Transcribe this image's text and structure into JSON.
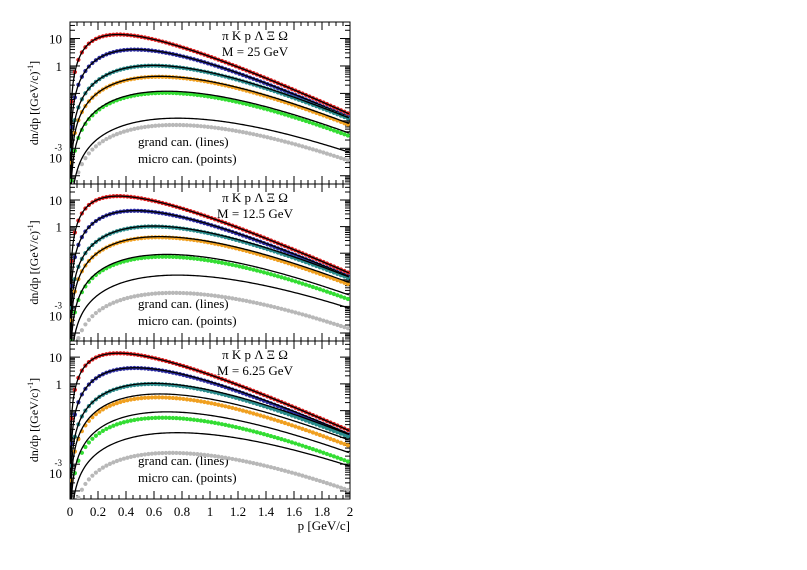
{
  "figure": {
    "x_axis_label": "p [GeV/c]",
    "x_tick_labels": [
      "0",
      "0.2",
      "0.4",
      "0.6",
      "0.8",
      "1",
      "1.2",
      "1.4",
      "1.6",
      "1.8",
      "2"
    ],
    "y_axis_label": "dn/dp [(GeV/c)",
    "y_axis_label_exp": "-1",
    "y_axis_label_close": "]",
    "particles_label": "π  K  p  Λ  Ξ  Ω",
    "legend_lines": "grand can. (lines)",
    "legend_points": "micro can. (points)",
    "y_tick_labels": [
      "10",
      "1",
      "10"
    ],
    "y_tick_exp": "-3"
  },
  "colors": {
    "pi": "#e02020",
    "K": "#2c2ca0",
    "p": "#2a8c8c",
    "Lambda": "#f0a020",
    "Xi": "#33dd33",
    "Omega": "#b8b8b8",
    "lines": "#000000"
  },
  "chart_data": [
    {
      "type": "line",
      "label": "M = 25 GeV",
      "xlabel": "p [GeV/c]",
      "ylabel": "dn/dp [(GeV/c)-1]",
      "xlim": [
        0,
        2
      ],
      "ylim": [
        5e-05,
        40
      ],
      "log_y": true,
      "series": [
        {
          "name": "π",
          "grand_peak": 14,
          "micro_factor": 1.0,
          "micro_slope": 0.0
        },
        {
          "name": "K",
          "grand_peak": 4.0,
          "micro_factor": 1.0,
          "micro_slope": 0.02
        },
        {
          "name": "p",
          "grand_peak": 1.05,
          "micro_factor": 1.0,
          "micro_slope": 0.04
        },
        {
          "name": "Λ",
          "grand_peak": 0.42,
          "micro_factor": 1.0,
          "micro_slope": 0.06
        },
        {
          "name": "Ξ",
          "grand_peak": 0.12,
          "micro_factor": 0.92,
          "micro_slope": 0.08
        },
        {
          "name": "Ω",
          "grand_peak": 0.0125,
          "micro_factor": 0.62,
          "micro_slope": 0.12
        }
      ]
    },
    {
      "type": "line",
      "label": "M = 12.5 GeV",
      "xlabel": "p [GeV/c]",
      "ylabel": "dn/dp [(GeV/c)-1]",
      "xlim": [
        0,
        2
      ],
      "ylim": [
        5e-05,
        40
      ],
      "log_y": true,
      "series": [
        {
          "name": "π",
          "grand_peak": 14,
          "micro_factor": 1.0,
          "micro_slope": 0.0
        },
        {
          "name": "K",
          "grand_peak": 4.0,
          "micro_factor": 1.0,
          "micro_slope": 0.03
        },
        {
          "name": "p",
          "grand_peak": 1.05,
          "micro_factor": 1.0,
          "micro_slope": 0.06
        },
        {
          "name": "Λ",
          "grand_peak": 0.42,
          "micro_factor": 1.0,
          "micro_slope": 0.09
        },
        {
          "name": "Ξ",
          "grand_peak": 0.09,
          "micro_factor": 0.9,
          "micro_slope": 0.14
        },
        {
          "name": "Ω",
          "grand_peak": 0.015,
          "micro_factor": 0.25,
          "micro_slope": 0.2
        }
      ]
    },
    {
      "type": "line",
      "label": "M = 6.25 GeV",
      "xlabel": "p [GeV/c]",
      "ylabel": "dn/dp [(GeV/c)-1]",
      "xlim": [
        0,
        2
      ],
      "ylim": [
        5e-05,
        40
      ],
      "log_y": true,
      "series": [
        {
          "name": "π",
          "grand_peak": 14,
          "micro_factor": 1.0,
          "micro_slope": 0.0
        },
        {
          "name": "K",
          "grand_peak": 4.0,
          "micro_factor": 1.0,
          "micro_slope": 0.05
        },
        {
          "name": "p",
          "grand_peak": 1.05,
          "micro_factor": 1.0,
          "micro_slope": 0.1
        },
        {
          "name": "Λ",
          "grand_peak": 0.42,
          "micro_factor": 0.82,
          "micro_slope": 0.15
        },
        {
          "name": "Ξ",
          "grand_peak": 0.09,
          "micro_factor": 0.7,
          "micro_slope": 0.22
        },
        {
          "name": "Ω",
          "grand_peak": 0.015,
          "micro_factor": 0.22,
          "micro_slope": 0.3
        }
      ]
    }
  ]
}
